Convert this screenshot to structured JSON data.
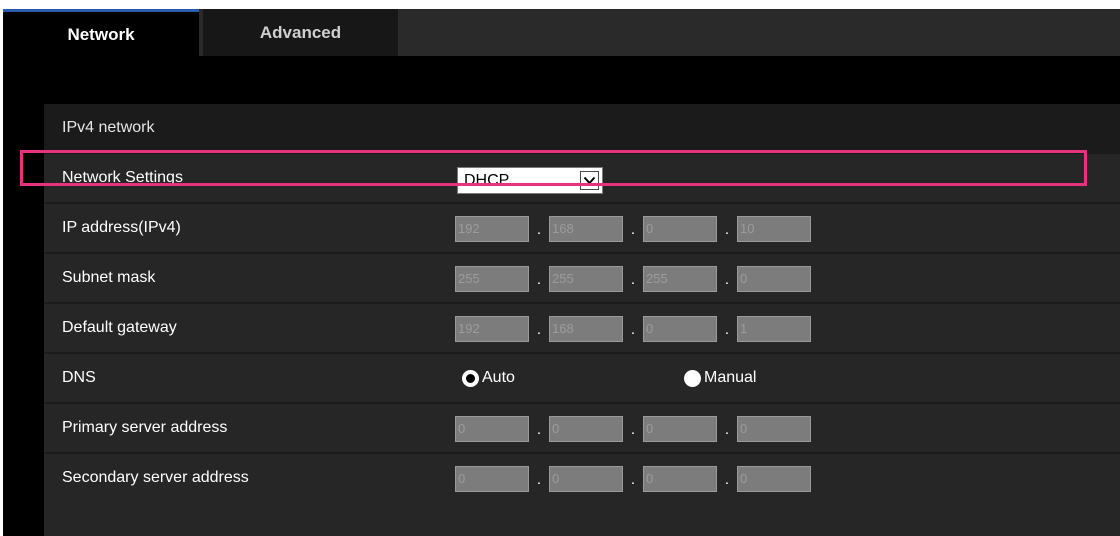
{
  "tabs": [
    {
      "label": "Network",
      "active": true
    },
    {
      "label": "Advanced",
      "active": false
    }
  ],
  "section": {
    "title": "IPv4 network"
  },
  "network_settings": {
    "label": "Network Settings",
    "selected": "DHCP"
  },
  "ip_address": {
    "label": "IP address(IPv4)",
    "octets": [
      "192",
      "168",
      "0",
      "10"
    ]
  },
  "subnet_mask": {
    "label": "Subnet mask",
    "octets": [
      "255",
      "255",
      "255",
      "0"
    ]
  },
  "default_gateway": {
    "label": "Default gateway",
    "octets": [
      "192",
      "168",
      "0",
      "1"
    ]
  },
  "dns": {
    "label": "DNS",
    "options": [
      {
        "label": "Auto",
        "checked": true
      },
      {
        "label": "Manual",
        "checked": false
      }
    ]
  },
  "primary_dns": {
    "label": "Primary server address",
    "octets": [
      "0",
      "0",
      "0",
      "0"
    ]
  },
  "secondary_dns": {
    "label": "Secondary server address",
    "octets": [
      "0",
      "0",
      "0",
      "0"
    ]
  },
  "icons": {
    "dropdown": "chevron-down-icon"
  },
  "colors": {
    "highlight": "#e6327f",
    "active_tab_border": "#2a5db0",
    "panel": "#1b1b1b",
    "row": "#262626"
  }
}
